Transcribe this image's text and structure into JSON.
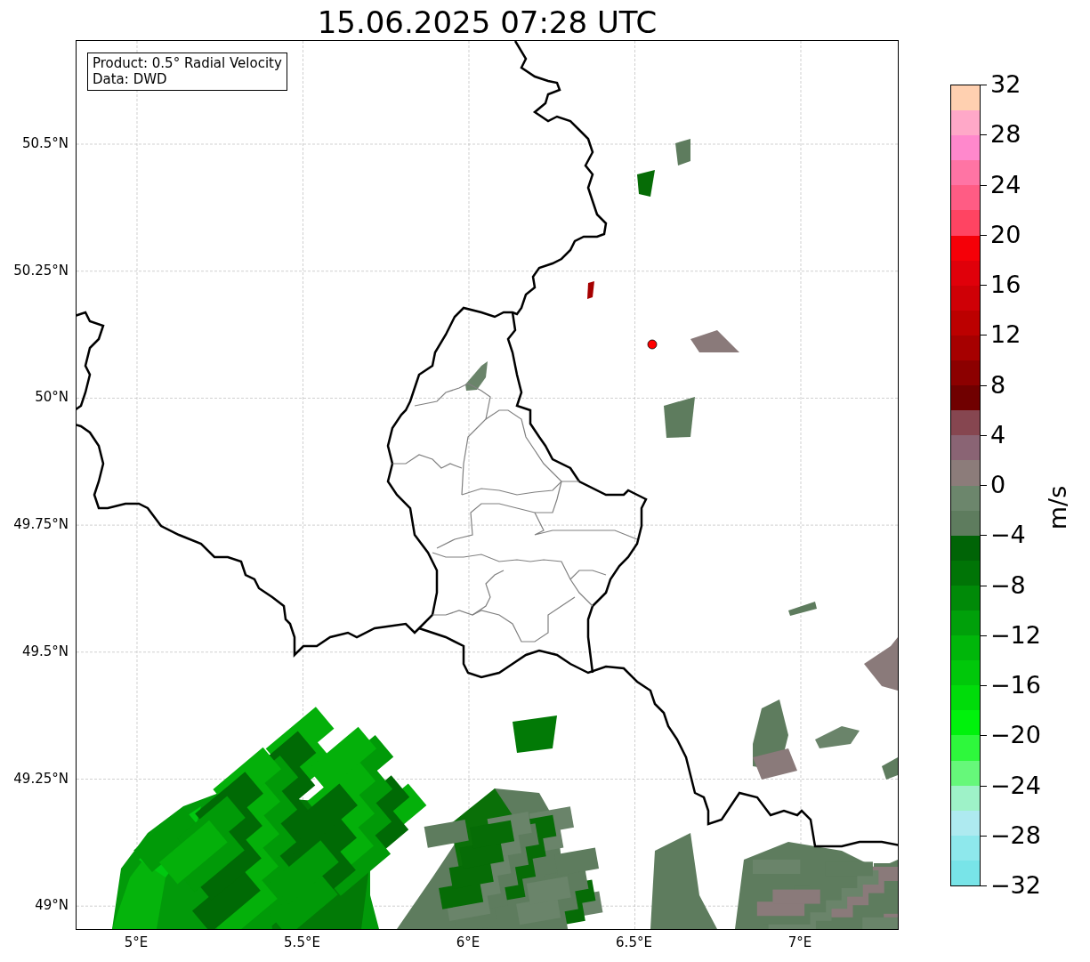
{
  "title": "15.06.2025 07:28 UTC",
  "info_box": {
    "lines": [
      "Product: 0.5° Radial Velocity",
      "Data: DWD"
    ]
  },
  "map": {
    "lat_labels": [
      "50.5°N",
      "50.25°N",
      "50°N",
      "49.75°N",
      "49.5°N",
      "49.25°N",
      "49°N"
    ],
    "lon_labels": [
      "5°E",
      "5.5°E",
      "6°E",
      "6.5°E",
      "7°E"
    ]
  },
  "colorbar": {
    "label": "m/s",
    "ticks": [
      "32",
      "28",
      "24",
      "20",
      "16",
      "12",
      "8",
      "4",
      "0",
      "−4",
      "−8",
      "−12",
      "−16",
      "−20",
      "−24",
      "−28",
      "−32"
    ],
    "bins": [
      {
        "color": "#ffd0b0"
      },
      {
        "color": "#ffa8c8"
      },
      {
        "color": "#ff88cc"
      },
      {
        "color": "#ff74a4"
      },
      {
        "color": "#ff5c84"
      },
      {
        "color": "#ff4462"
      },
      {
        "color": "#f50008"
      },
      {
        "color": "#e0000a"
      },
      {
        "color": "#cf0006"
      },
      {
        "color": "#bc0000"
      },
      {
        "color": "#a60000"
      },
      {
        "color": "#8c0000"
      },
      {
        "color": "#700000"
      },
      {
        "color": "#864650"
      },
      {
        "color": "#8a6474"
      },
      {
        "color": "#8c7c7a"
      },
      {
        "color": "#6c866c"
      },
      {
        "color": "#5e7c5e"
      },
      {
        "color": "#006406"
      },
      {
        "color": "#007406"
      },
      {
        "color": "#008a08"
      },
      {
        "color": "#00a00a"
      },
      {
        "color": "#00b60a"
      },
      {
        "color": "#00c80a"
      },
      {
        "color": "#00dc0a"
      },
      {
        "color": "#00f20c"
      },
      {
        "color": "#2ef83c"
      },
      {
        "color": "#66f87a"
      },
      {
        "color": "#9ef2c8"
      },
      {
        "color": "#aeeaf0"
      },
      {
        "color": "#8ee8ec"
      },
      {
        "color": "#78e4e8"
      }
    ]
  }
}
